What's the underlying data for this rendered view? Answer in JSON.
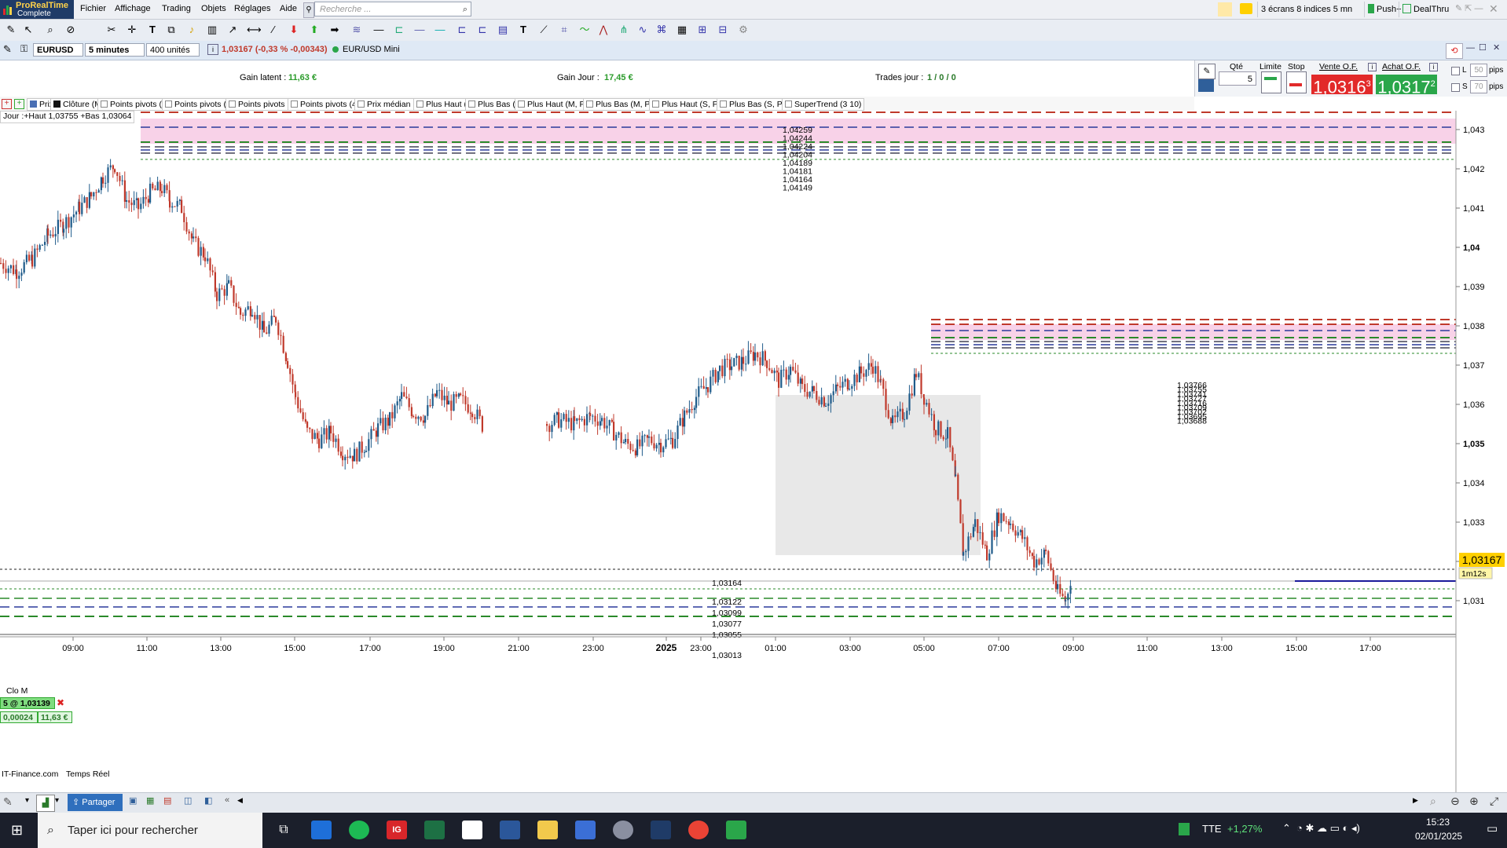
{
  "app": {
    "name_line1": "ProRealTime",
    "name_line2": "Complete"
  },
  "menu": [
    "Fichier",
    "Affichage",
    "Trading",
    "Objets",
    "Réglages",
    "Aide"
  ],
  "search": {
    "placeholder": "Recherche ..."
  },
  "topright": {
    "screens": "3 écrans 8 indices 5 mn",
    "push": "Push+",
    "dealthru": "DealThru"
  },
  "instrument": {
    "symbol": "EURUSD",
    "timeframe": "5 minutes",
    "units": "400 unités",
    "price_change": "1,03167 (-0,33 % -0,00343)",
    "name": "EUR/USD Mini"
  },
  "account": {
    "gain_latent_label": "Gain latent :",
    "gain_latent_value": "11,63 €",
    "gain_jour_label": "Gain Jour :",
    "gain_jour_value": "17,45 €",
    "trades_label": "Trades jour :",
    "trades_value": "1 / 0 / 0"
  },
  "order": {
    "qty_label": "Qté",
    "qty_value": "5",
    "limit_label": "Limite",
    "stop_label": "Stop",
    "sell_label": "Vente O.F.",
    "sell_price": "1,0316",
    "sell_sup": "3",
    "buy_label": "Achat O.F.",
    "buy_price": "1,0317",
    "buy_sup": "2",
    "l_label": "L",
    "l_value": "50",
    "s_label": "S",
    "s_value": "70",
    "pips": "pips"
  },
  "indicators": [
    "Prix",
    "Clôture (M)",
    "Points pivots (M)",
    "Points pivots (S)",
    "Points pivots (J)",
    "Points pivots (4h)",
    "Prix médian (J)",
    "Plus Haut (J)",
    "Plus Bas (J)",
    "Plus Haut (M, Pré)",
    "Plus Bas (M, Pré)",
    "Plus Haut (S, Pré)",
    "Plus Bas (S, Pré)",
    "SuperTrend (3 10)"
  ],
  "day_info": "Jour :+Haut 1,03755 +Bas 1,03064",
  "position": {
    "clo_label": "Clo M",
    "qty_price": "5 @ 1,03139",
    "pips": "0,00024",
    "gain": "11,63 €"
  },
  "footer": {
    "source": "IT-Finance.com",
    "mode": "Temps Réel",
    "share": "Partager"
  },
  "colors": {
    "up": "#1f5b8a",
    "down": "#c0392b",
    "sell": "#e22a2a",
    "buy": "#2aa64a",
    "zone": "#f8d2e8"
  },
  "taskbar": {
    "search_placeholder": "Taper ici pour rechercher",
    "ticker": "TTE",
    "ticker_change": "+1,27%",
    "time": "15:23",
    "date": "02/01/2025"
  },
  "chart_data": {
    "type": "candlestick",
    "y_ticks": [
      "1,043",
      "1,042",
      "1,041",
      "1,04",
      "1,039",
      "1,038",
      "1,037",
      "1,036",
      "1,035",
      "1,034",
      "1,033",
      "1,032",
      "1,031"
    ],
    "ylim": [
      1.0302,
      1.0434
    ],
    "x_ticks": [
      "09:00",
      "11:00",
      "13:00",
      "15:00",
      "17:00",
      "19:00",
      "21:00",
      "23:00",
      "2025",
      "23:00",
      "01:00",
      "03:00",
      "05:00",
      "07:00",
      "09:00",
      "11:00",
      "13:00",
      "15:00",
      "17:00"
    ],
    "current_price": "1,03167",
    "timer": "1m12s",
    "level_labels_top": [
      "1,04259",
      "1,04244",
      "1,04224",
      "1,04204",
      "1,04189",
      "1,04181",
      "1,04164",
      "1,04149"
    ],
    "level_labels_mid": [
      "1,03766",
      "1,03755",
      "1,03741",
      "1,03727",
      "1,03716",
      "1,03709",
      "1,03702",
      "1,03695",
      "1,03688"
    ],
    "level_labels_bottom": [
      "1,03164",
      "1,03122",
      "1,03099",
      "1,03077",
      "1,03055",
      "1,03013"
    ],
    "trend_path": [
      [
        0,
        1.0396
      ],
      [
        20,
        1.0394
      ],
      [
        40,
        1.0397
      ],
      [
        60,
        1.0403
      ],
      [
        80,
        1.0406
      ],
      [
        100,
        1.041
      ],
      [
        115,
        1.0413
      ],
      [
        130,
        1.0418
      ],
      [
        145,
        1.0421
      ],
      [
        160,
        1.0412
      ],
      [
        175,
        1.041
      ],
      [
        190,
        1.0414
      ],
      [
        205,
        1.0415
      ],
      [
        215,
        1.0412
      ],
      [
        230,
        1.041
      ],
      [
        245,
        1.0401
      ],
      [
        260,
        1.0398
      ],
      [
        275,
        1.0388
      ],
      [
        290,
        1.039
      ],
      [
        305,
        1.0383
      ],
      [
        320,
        1.0385
      ],
      [
        335,
        1.0378
      ],
      [
        350,
        1.0382
      ],
      [
        365,
        1.0371
      ],
      [
        375,
        1.0362
      ],
      [
        390,
        1.0353
      ],
      [
        405,
        1.0351
      ],
      [
        420,
        1.0353
      ],
      [
        435,
        1.0348
      ],
      [
        450,
        1.0347
      ],
      [
        465,
        1.035
      ],
      [
        480,
        1.0354
      ],
      [
        495,
        1.0356
      ],
      [
        510,
        1.0362
      ],
      [
        525,
        1.0358
      ],
      [
        540,
        1.0357
      ],
      [
        555,
        1.0363
      ],
      [
        570,
        1.036
      ],
      [
        585,
        1.0361
      ],
      [
        600,
        1.0359
      ],
      [
        615,
        1.0354
      ],
      [
        695,
        1.0355
      ],
      [
        710,
        1.0356
      ],
      [
        730,
        1.0355
      ],
      [
        750,
        1.0357
      ],
      [
        765,
        1.0356
      ],
      [
        780,
        1.0353
      ],
      [
        795,
        1.035
      ],
      [
        810,
        1.0349
      ],
      [
        825,
        1.0351
      ],
      [
        840,
        1.035
      ],
      [
        855,
        1.0351
      ],
      [
        870,
        1.0357
      ],
      [
        885,
        1.0362
      ],
      [
        900,
        1.0365
      ],
      [
        915,
        1.0369
      ],
      [
        930,
        1.037
      ],
      [
        945,
        1.0371
      ],
      [
        960,
        1.0373
      ],
      [
        975,
        1.0371
      ],
      [
        990,
        1.0366
      ],
      [
        1005,
        1.0369
      ],
      [
        1020,
        1.0364
      ],
      [
        1035,
        1.0363
      ],
      [
        1050,
        1.0361
      ],
      [
        1065,
        1.0364
      ],
      [
        1080,
        1.0366
      ],
      [
        1095,
        1.0368
      ],
      [
        1110,
        1.037
      ],
      [
        1120,
        1.0365
      ],
      [
        1135,
        1.0355
      ],
      [
        1150,
        1.0358
      ],
      [
        1165,
        1.0368
      ],
      [
        1175,
        1.0362
      ],
      [
        1190,
        1.0354
      ],
      [
        1205,
        1.0352
      ],
      [
        1215,
        1.034
      ],
      [
        1225,
        1.0322
      ],
      [
        1240,
        1.033
      ],
      [
        1255,
        1.0322
      ],
      [
        1270,
        1.0332
      ],
      [
        1285,
        1.033
      ],
      [
        1300,
        1.0326
      ],
      [
        1315,
        1.032
      ],
      [
        1330,
        1.0322
      ],
      [
        1345,
        1.0312
      ],
      [
        1355,
        1.031
      ],
      [
        1362,
        1.0316
      ]
    ]
  }
}
